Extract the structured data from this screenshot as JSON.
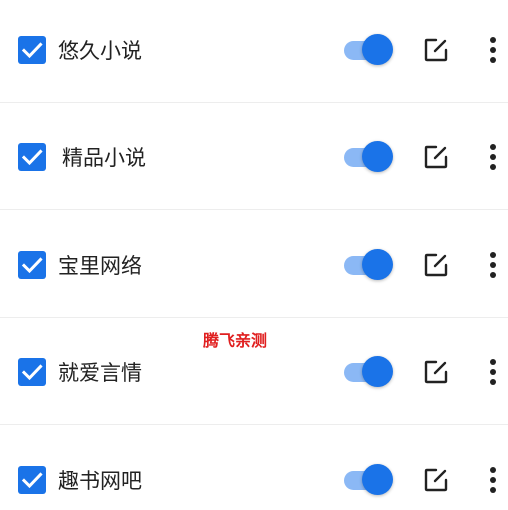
{
  "colors": {
    "accent": "#1a73e8",
    "track": "#8bb8f5",
    "text": "#222222",
    "divider": "#ededed",
    "watermark": "#e02020"
  },
  "icons": {
    "checkbox": "check-icon",
    "edit": "edit-icon",
    "more": "more-vertical-icon"
  },
  "sources": [
    {
      "name": "悠久小说",
      "checked": true,
      "enabled": true
    },
    {
      "name": "精品小说",
      "checked": true,
      "enabled": true
    },
    {
      "name": "宝里网络",
      "checked": true,
      "enabled": true
    },
    {
      "name": "就爱言情",
      "checked": true,
      "enabled": true
    },
    {
      "name": "趣书网吧",
      "checked": true,
      "enabled": true
    }
  ],
  "watermark": "腾飞亲测"
}
